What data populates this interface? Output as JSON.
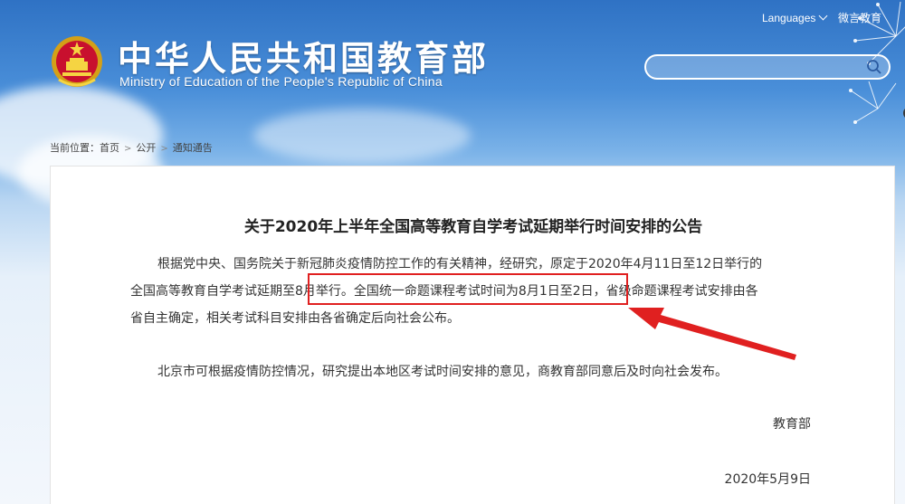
{
  "header": {
    "site_title": "中华人民共和国教育部",
    "site_subtitle": "Ministry of Education of the People's Republic of China",
    "languages_label": "Languages",
    "weiyan_label": "微言教育",
    "search_placeholder": ""
  },
  "breadcrumb": {
    "prefix": "当前位置：",
    "items": [
      "首页",
      "公开",
      "通知通告"
    ]
  },
  "article": {
    "title": "关于2020年上半年全国高等教育自学考试延期举行时间安排的公告",
    "para1_line1": "根据党中央、国务院关于新冠肺炎疫情防控工作的有关精神，经研究，原定于2020年4月11日至12日举行的",
    "para1_line2_a": "全国高等教育自学考试延期至8月举行。",
    "para1_line2_highlight": "全国统一命题课程考试时间为8月1日至2日",
    "para1_line2_b": "，省级命题课程考试安排由各",
    "para1_line3": "省自主确定，相关考试科目安排由各省确定后向社会公布。",
    "para2": "北京市可根据疫情防控情况，研究提出本地区考试时间安排的意见，商教育部同意后及时向社会发布。",
    "signature": "教育部",
    "date": "2020年5月9日"
  },
  "colors": {
    "highlight": "#e02020",
    "header_blue": "#2f72c4"
  }
}
